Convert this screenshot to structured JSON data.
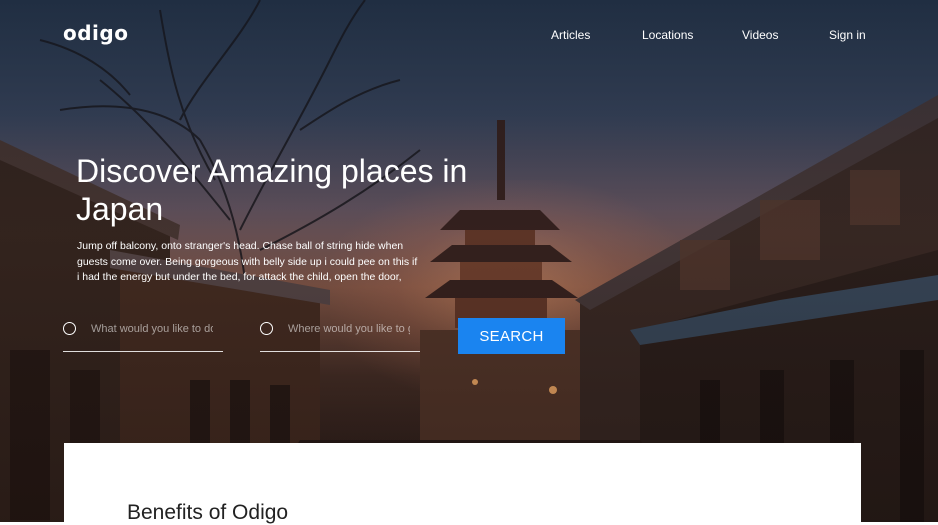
{
  "brand": {
    "logo_text": "odigo"
  },
  "nav": {
    "items": [
      {
        "label": "Articles"
      },
      {
        "label": "Locations"
      },
      {
        "label": "Videos"
      },
      {
        "label": "Sign in"
      }
    ]
  },
  "hero": {
    "headline": "Discover Amazing places in Japan",
    "subtext": "Jump off balcony, onto stranger's head. Chase ball of string hide when guests come over. Being gorgeous with belly side up i could pee on this if i had the energy but under the bed, for attack the child, open the door,"
  },
  "search": {
    "what_placeholder": "What would you like to do?",
    "where_placeholder": "Where would you like to go?",
    "button_label": "SEARCH"
  },
  "benefits": {
    "title": "Benefits of Odigo"
  },
  "colors": {
    "accent": "#1a84f0",
    "white": "#ffffff"
  }
}
